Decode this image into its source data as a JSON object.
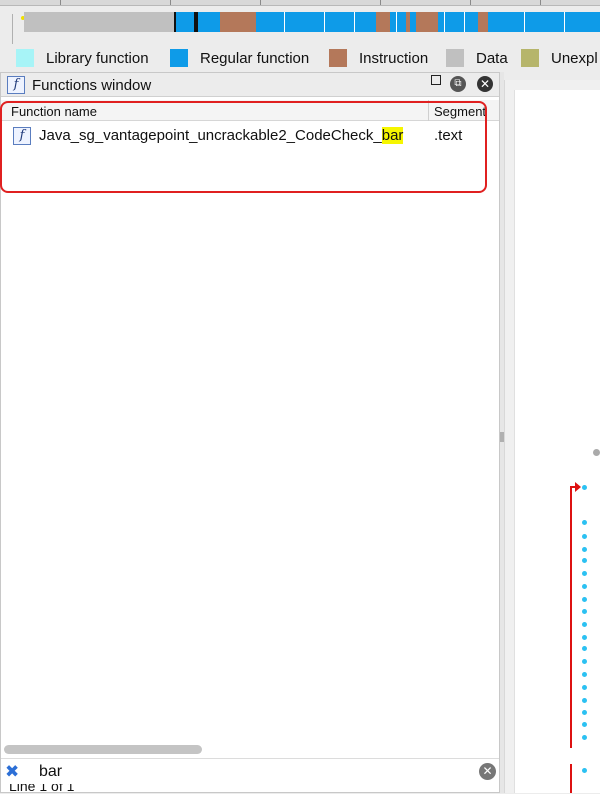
{
  "legend": {
    "items": [
      {
        "label": "Library function",
        "color": "#a7f4f7"
      },
      {
        "label": "Regular function",
        "color": "#0e9be8"
      },
      {
        "label": "Instruction",
        "color": "#b4785a"
      },
      {
        "label": "Data",
        "color": "#c0c0c0"
      },
      {
        "label": "Unexpl",
        "color": "#b6b56b"
      }
    ]
  },
  "functions_window": {
    "title": "Functions window",
    "columns": [
      "Function name",
      "Segment"
    ],
    "rows": [
      {
        "name_prefix": "Java_sg_vantagepoint_uncrackable2_CodeCheck_",
        "name_match": "bar",
        "segment": ".text"
      }
    ],
    "filter_value": "bar",
    "status": "Line 1 of 1"
  },
  "icons": {
    "function_icon": "function-f-icon",
    "float_icon": "float-window-icon",
    "close_icon": "close-icon",
    "filter_icon": "filter-x-icon",
    "clear_icon": "clear-x-icon"
  },
  "colors": {
    "highlight": "#f6f600",
    "annotation_red": "#e02020",
    "graph_dots": "#2cc1f2"
  }
}
